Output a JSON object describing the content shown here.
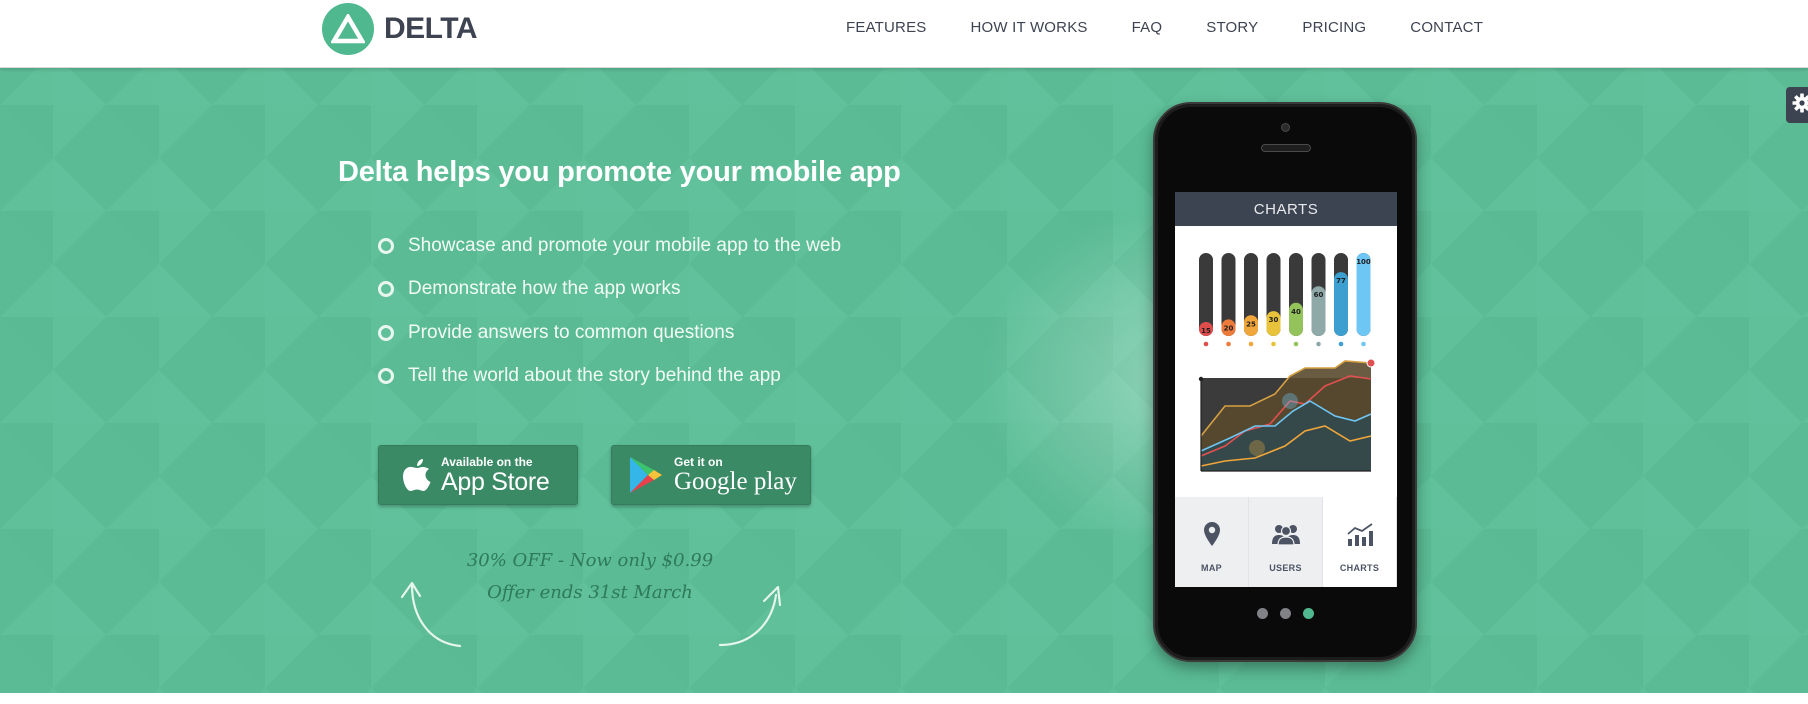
{
  "brand": {
    "name": "DELTA",
    "color": "#4fb88e"
  },
  "nav": {
    "items": [
      {
        "label": "FEATURES"
      },
      {
        "label": "HOW IT WORKS"
      },
      {
        "label": "FAQ"
      },
      {
        "label": "STORY"
      },
      {
        "label": "PRICING"
      },
      {
        "label": "CONTACT"
      }
    ]
  },
  "hero": {
    "title": "Delta helps you promote your mobile app",
    "bullets": [
      "Showcase and promote your mobile app to the web",
      "Demonstrate how the app works",
      "Provide answers to common questions",
      "Tell the world about the story behind the app"
    ],
    "background_color": "#5abb95"
  },
  "buttons": {
    "appstore": {
      "small": "Available on the",
      "big": "App Store",
      "icon": "apple-icon"
    },
    "google": {
      "small": "Get it on",
      "big": "Google play",
      "icon": "google-play-icon"
    }
  },
  "offer": {
    "line1": "30% OFF - Now only $0.99",
    "line2": "Offer ends 31st March"
  },
  "phone": {
    "screen_title": "CHARTS",
    "bar_values": [
      15,
      20,
      25,
      30,
      40,
      60,
      77,
      100
    ],
    "bar_colors": [
      "#e04b4b",
      "#ec7a3a",
      "#f0a63a",
      "#e8c23a",
      "#93c35a",
      "#8fa9a9",
      "#3d9fcf",
      "#6ec6f5"
    ],
    "tabs": [
      {
        "label": "MAP",
        "icon": "map-pin-icon"
      },
      {
        "label": "USERS",
        "icon": "users-icon"
      },
      {
        "label": "CHARTS",
        "icon": "chart-icon"
      }
    ],
    "active_tab": "CHARTS",
    "slide_count": 3,
    "active_slide": 3
  },
  "settings": {
    "icon": "gear-icon"
  }
}
